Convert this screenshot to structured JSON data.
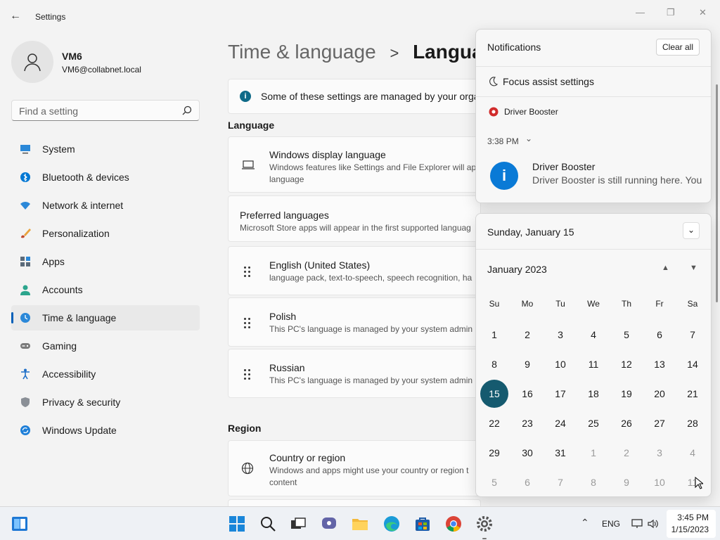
{
  "window": {
    "title": "Settings"
  },
  "user": {
    "name": "VM6",
    "email": "VM6@collabnet.local"
  },
  "search": {
    "placeholder": "Find a setting"
  },
  "sidebar": {
    "items": [
      {
        "label": "System",
        "icon": "monitor-icon"
      },
      {
        "label": "Bluetooth & devices",
        "icon": "bluetooth-icon"
      },
      {
        "label": "Network & internet",
        "icon": "wifi-icon"
      },
      {
        "label": "Personalization",
        "icon": "brush-icon"
      },
      {
        "label": "Apps",
        "icon": "apps-icon"
      },
      {
        "label": "Accounts",
        "icon": "person-icon"
      },
      {
        "label": "Time & language",
        "icon": "clock-globe-icon",
        "active": true
      },
      {
        "label": "Gaming",
        "icon": "gamepad-icon"
      },
      {
        "label": "Accessibility",
        "icon": "accessibility-icon"
      },
      {
        "label": "Privacy & security",
        "icon": "shield-icon"
      },
      {
        "label": "Windows Update",
        "icon": "refresh-icon"
      }
    ]
  },
  "breadcrumb": {
    "parent": "Time & language",
    "separator": ">",
    "current": "Languag"
  },
  "banner": {
    "text": "Some of these settings are managed by your orga"
  },
  "language": {
    "heading": "Language",
    "display": {
      "title": "Windows display language",
      "desc": "Windows features like Settings and File Explorer will ap language"
    },
    "preferred": {
      "title": "Preferred languages",
      "desc": "Microsoft Store apps will appear in the first supported languag"
    },
    "languages": [
      {
        "title": "English (United States)",
        "desc": "language pack, text-to-speech, speech recognition, ha"
      },
      {
        "title": "Polish",
        "desc": "This PC's language is managed by your system admin"
      },
      {
        "title": "Russian",
        "desc": "This PC's language is managed by your system admin"
      }
    ]
  },
  "region": {
    "heading": "Region",
    "country": {
      "title": "Country or region",
      "desc": "Windows and apps might use your country or region t content"
    }
  },
  "notifications": {
    "title": "Notifications",
    "clear_all": "Clear all",
    "focus_assist": "Focus assist settings",
    "app_name": "Driver Booster",
    "time": "3:38 PM",
    "toast_title": "Driver Booster",
    "toast_body": "Driver Booster is still running here. You"
  },
  "calendar": {
    "date_header": "Sunday, January 15",
    "month": "January 2023",
    "weekdays": [
      "Su",
      "Mo",
      "Tu",
      "We",
      "Th",
      "Fr",
      "Sa"
    ],
    "days": [
      [
        "1",
        "2",
        "3",
        "4",
        "5",
        "6",
        "7"
      ],
      [
        "8",
        "9",
        "10",
        "11",
        "12",
        "13",
        "14"
      ],
      [
        "15",
        "16",
        "17",
        "18",
        "19",
        "20",
        "21"
      ],
      [
        "22",
        "23",
        "24",
        "25",
        "26",
        "27",
        "28"
      ],
      [
        "29",
        "30",
        "31",
        "1",
        "2",
        "3",
        "4"
      ],
      [
        "5",
        "6",
        "7",
        "8",
        "9",
        "10",
        "11"
      ]
    ],
    "today": "15"
  },
  "taskbar": {
    "lang": "ENG",
    "time": "3:45 PM",
    "date": "1/15/2023"
  },
  "colors": {
    "accent": "#005fb8",
    "today": "#155a6f"
  }
}
